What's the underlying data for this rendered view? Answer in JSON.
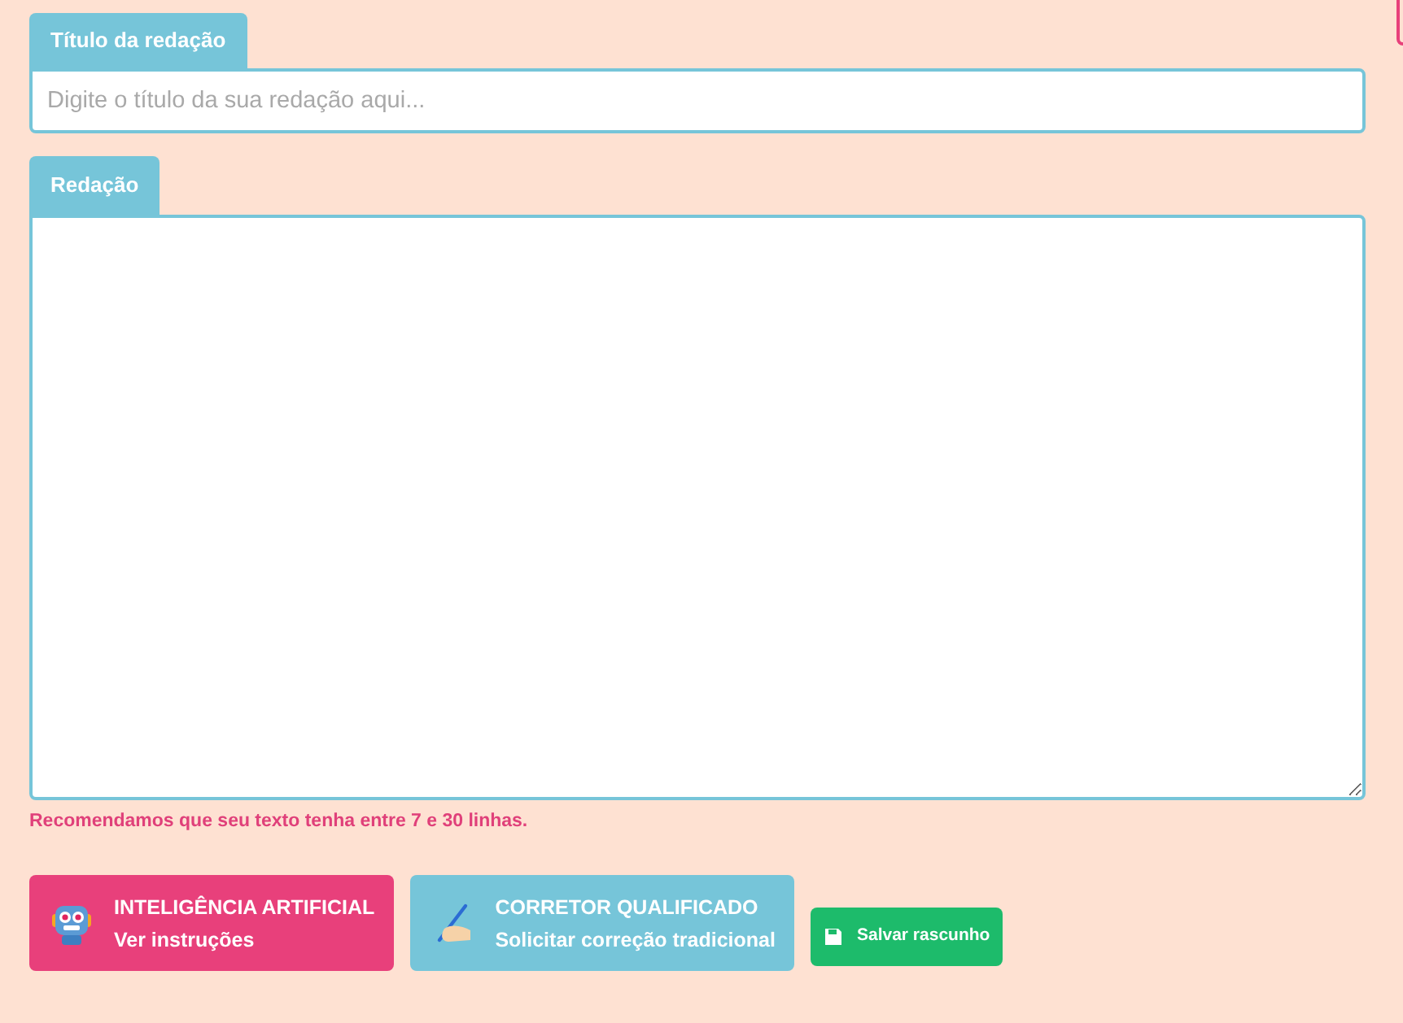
{
  "title_field": {
    "label": "Título da redação",
    "placeholder": "Digite o título da sua redação aqui..."
  },
  "essay_field": {
    "label": "Redação"
  },
  "hint": "Recomendamos que seu texto tenha entre 7 e 30 linhas.",
  "actions": [
    {
      "kind": "ai",
      "title": "INTELIGÊNCIA ARTIFICIAL",
      "subtitle": "Ver instruções"
    },
    {
      "kind": "tutor",
      "title": "CORRETOR QUALIFICADO",
      "subtitle": "Solicitar correção tradicional"
    },
    {
      "kind": "save",
      "label": "Salvar rascunho"
    }
  ]
}
